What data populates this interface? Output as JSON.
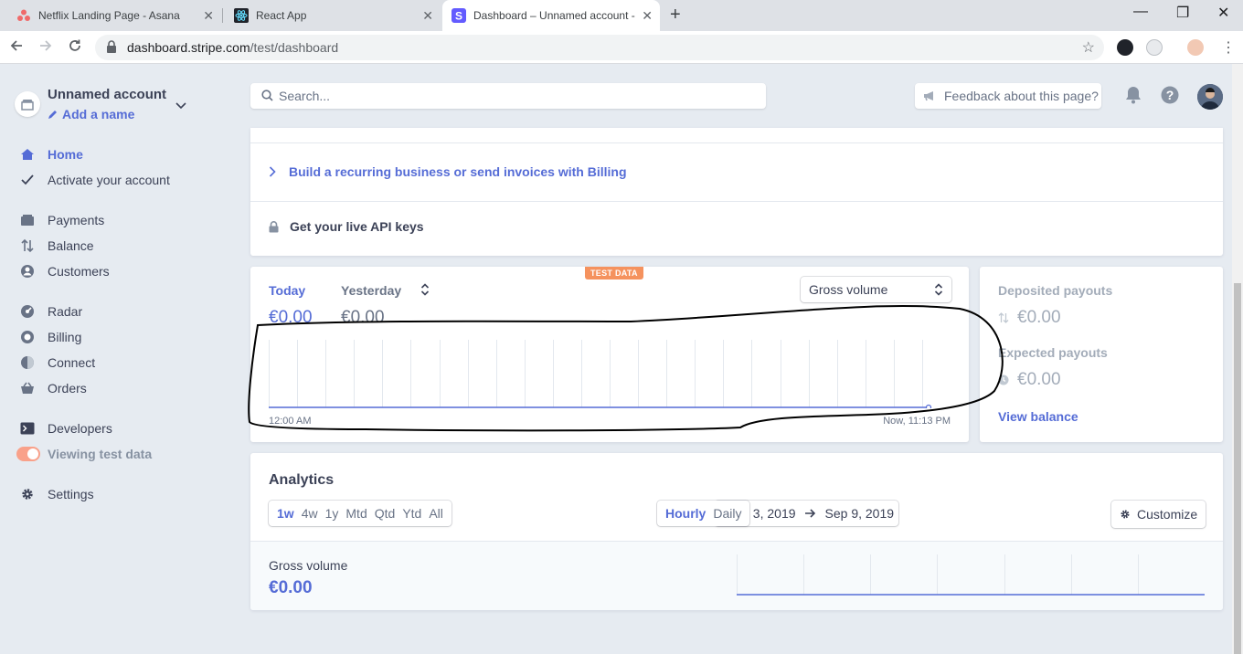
{
  "browser": {
    "tabs": [
      {
        "title": "Netflix Landing Page - Asana",
        "favicon": "asana-icon"
      },
      {
        "title": "React App",
        "favicon": "react-icon"
      },
      {
        "title": "Dashboard – Unnamed account - ",
        "favicon": "stripe-icon",
        "active": true
      }
    ],
    "url_domain": "dashboard.stripe.com",
    "url_path": "/test/dashboard"
  },
  "account": {
    "name": "Unnamed account",
    "add_name": "Add a name"
  },
  "sidebar": {
    "items": [
      {
        "label": "Home",
        "icon": "home-icon",
        "active": true
      },
      {
        "label": "Activate your account",
        "icon": "check-icon"
      },
      {
        "label": "Payments",
        "icon": "payments-icon"
      },
      {
        "label": "Balance",
        "icon": "balance-icon"
      },
      {
        "label": "Customers",
        "icon": "customers-icon"
      },
      {
        "label": "Radar",
        "icon": "radar-icon"
      },
      {
        "label": "Billing",
        "icon": "billing-icon"
      },
      {
        "label": "Connect",
        "icon": "connect-icon"
      },
      {
        "label": "Orders",
        "icon": "orders-icon"
      },
      {
        "label": "Developers",
        "icon": "terminal-icon"
      },
      {
        "label": "Viewing test data",
        "icon": "toggle"
      },
      {
        "label": "Settings",
        "icon": "gear-icon"
      }
    ]
  },
  "header": {
    "search_placeholder": "Search...",
    "feedback": "Feedback about this page?"
  },
  "tasks": {
    "billing": "Build a recurring business or send invoices with Billing",
    "api_keys": "Get your live API keys"
  },
  "today_card": {
    "badge": "TEST DATA",
    "today_label": "Today",
    "today_value": "€0.00",
    "compare_label": "Yesterday",
    "compare_value": "€0.00",
    "metric": "Gross volume",
    "x_start": "12:00 AM",
    "x_end": "Now, 11:13 PM"
  },
  "payouts_card": {
    "deposited_label": "Deposited payouts",
    "deposited_value": "€0.00",
    "expected_label": "Expected payouts",
    "expected_value": "€0.00",
    "link": "View balance"
  },
  "analytics": {
    "title": "Analytics",
    "periods": [
      "1w",
      "4w",
      "1y",
      "Mtd",
      "Qtd",
      "Ytd",
      "All"
    ],
    "active_period": "1w",
    "range_start": "Sep 3, 2019",
    "range_end": "Sep 9, 2019",
    "granularity": [
      "Hourly",
      "Daily"
    ],
    "active_granularity": "Hourly",
    "customize": "Customize",
    "gross_label": "Gross volume",
    "gross_value": "€0.00"
  },
  "colors": {
    "accent": "#556cd6",
    "badge": "#f5925e",
    "background": "#e6ebf1"
  }
}
